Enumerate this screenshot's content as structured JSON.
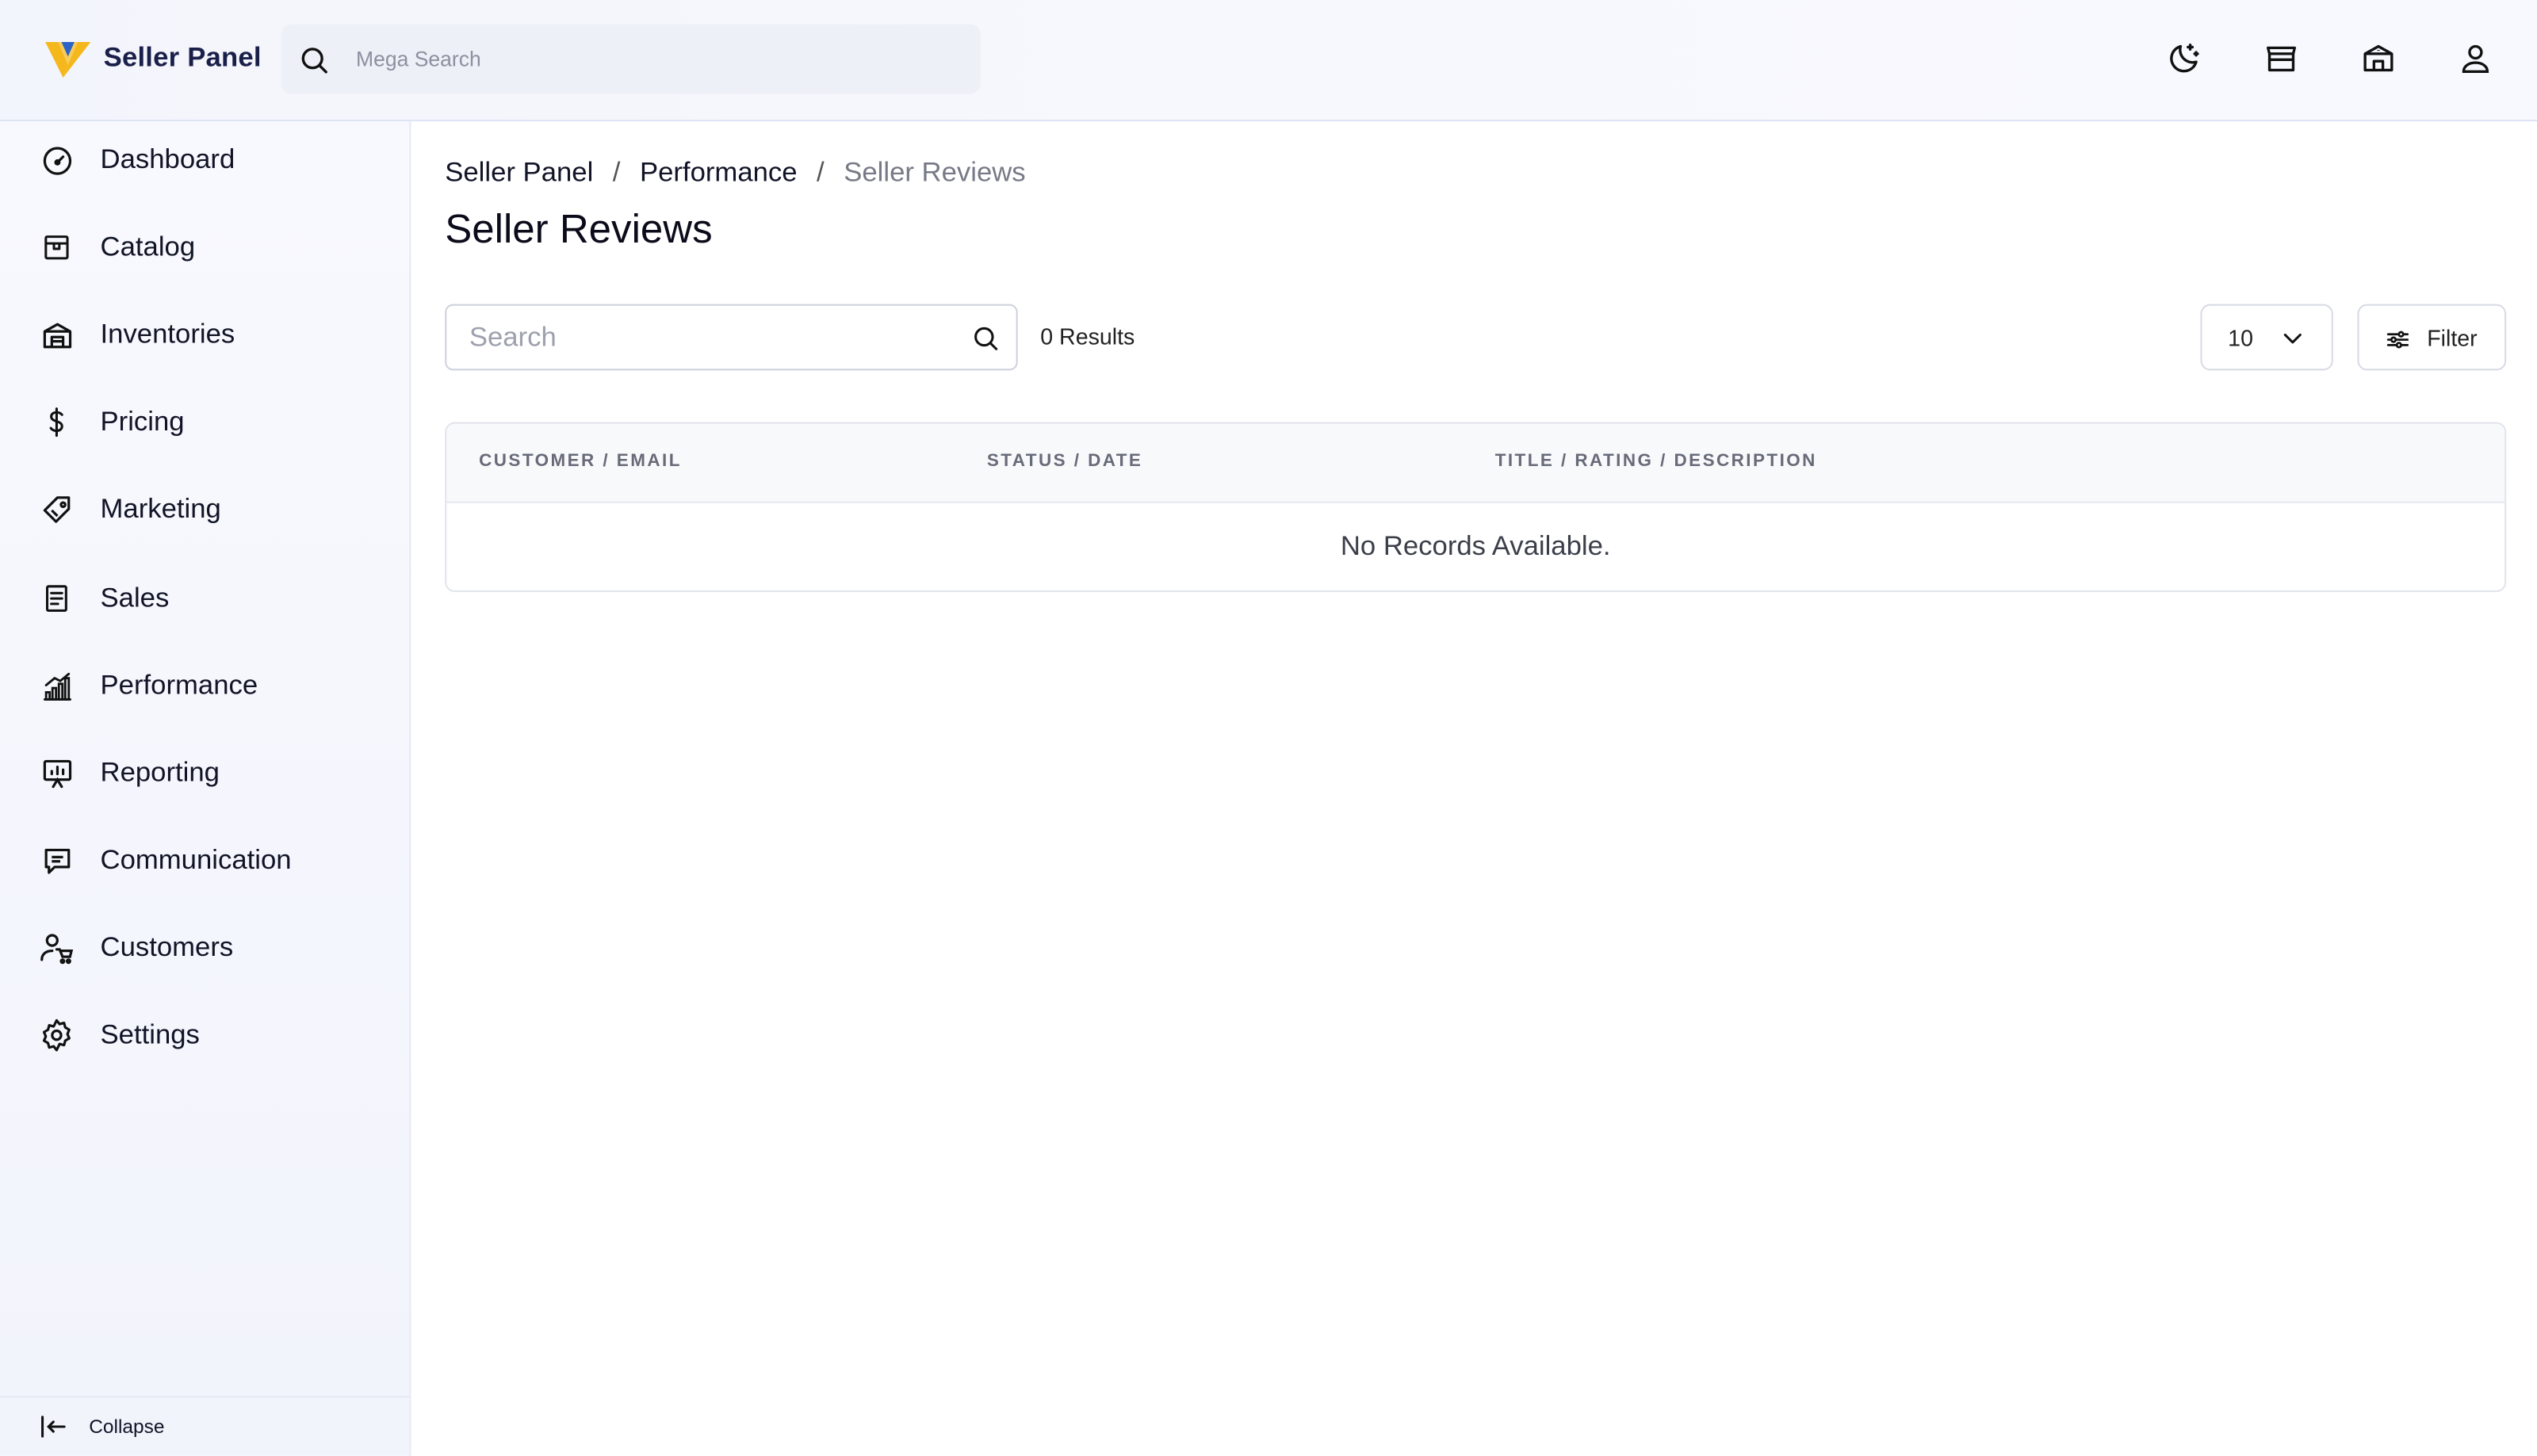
{
  "header": {
    "brand_name": "Seller Panel",
    "mega_search_placeholder": "Mega Search",
    "icons": [
      "moon-icon",
      "store-icon",
      "warehouse-icon",
      "user-icon"
    ]
  },
  "sidebar": {
    "items": [
      {
        "label": "Dashboard",
        "icon": "gauge-icon"
      },
      {
        "label": "Catalog",
        "icon": "box-icon"
      },
      {
        "label": "Inventories",
        "icon": "warehouse-icon"
      },
      {
        "label": "Pricing",
        "icon": "dollar-icon"
      },
      {
        "label": "Marketing",
        "icon": "tag-icon"
      },
      {
        "label": "Sales",
        "icon": "receipt-icon"
      },
      {
        "label": "Performance",
        "icon": "bar-chart-icon"
      },
      {
        "label": "Reporting",
        "icon": "presentation-icon"
      },
      {
        "label": "Communication",
        "icon": "message-icon"
      },
      {
        "label": "Customers",
        "icon": "customer-cart-icon"
      },
      {
        "label": "Settings",
        "icon": "gear-icon"
      }
    ],
    "collapse_label": "Collapse"
  },
  "breadcrumb": {
    "items": [
      "Seller Panel",
      "Performance",
      "Seller Reviews"
    ],
    "separator": "/"
  },
  "page": {
    "title": "Seller Reviews",
    "search_placeholder": "Search",
    "results_text": "0 Results",
    "page_size": "10",
    "filter_label": "Filter"
  },
  "table": {
    "columns": [
      "CUSTOMER / EMAIL",
      "STATUS / DATE",
      "TITLE / RATING / DESCRIPTION"
    ],
    "empty_text": "No Records Available."
  },
  "colors": {
    "accent_yellow": "#f5b81c",
    "brand_navy": "#1a1f4a"
  }
}
